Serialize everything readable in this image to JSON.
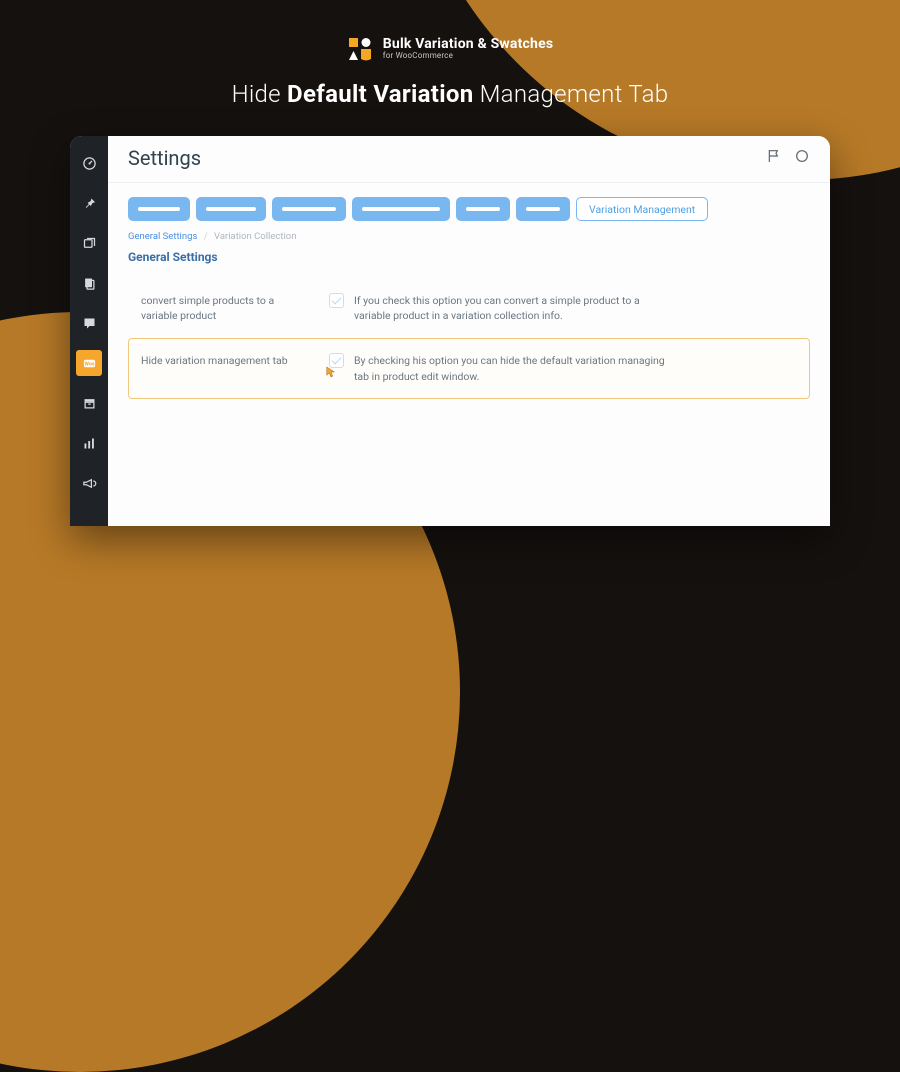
{
  "brand": {
    "name": "Bulk Variation & Swatches",
    "for": "for WooCommerce"
  },
  "slogan": {
    "pre": "Hide ",
    "strong": "Default Variation",
    "post": " Management Tab"
  },
  "page": {
    "title": "Settings"
  },
  "sidebar": {
    "items": [
      {
        "name": "dashboard-icon"
      },
      {
        "name": "pin-icon"
      },
      {
        "name": "media-icon"
      },
      {
        "name": "pages-icon"
      },
      {
        "name": "comments-icon"
      },
      {
        "name": "woo-icon",
        "active": true
      },
      {
        "name": "archive-icon"
      },
      {
        "name": "stats-icon"
      },
      {
        "name": "megaphone-icon"
      }
    ]
  },
  "tabs": {
    "active_label": "Variation Management"
  },
  "breadcrumbs": {
    "a": "General Settings",
    "b": "Variation Collection"
  },
  "section": {
    "title": "General Settings"
  },
  "settings": [
    {
      "label": "convert simple products to a variable product",
      "desc": "If you check this option you can convert a simple product to a variable product in a variation collection info."
    },
    {
      "label": "Hide variation management tab",
      "desc": "By checking his option you can hide the default variation managing tab in product edit window."
    }
  ]
}
